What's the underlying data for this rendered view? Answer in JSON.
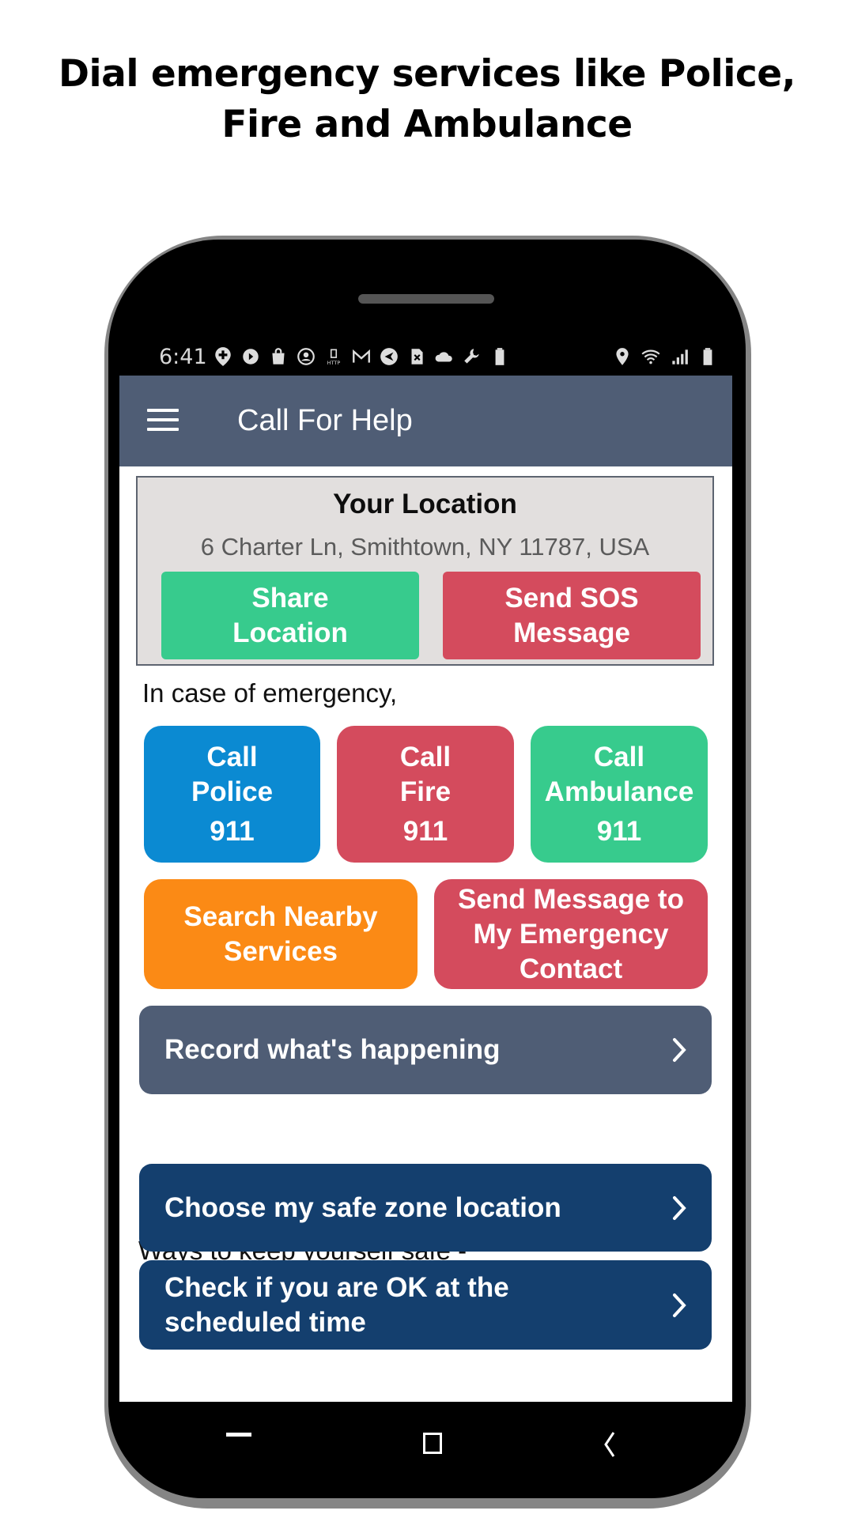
{
  "headline": {
    "line1": "Dial emergency services like Police,",
    "line2": "Fire and Ambulance"
  },
  "status_bar": {
    "time": "6:41",
    "left_icons": [
      "medical-location-icon",
      "play-icon",
      "shopping-bag-icon",
      "account-icon",
      "http-icon",
      "gmail-icon",
      "send-icon",
      "sim-error-icon",
      "cloud-icon",
      "wrench-icon",
      "battery-100-icon"
    ],
    "right_icons": [
      "location-icon",
      "wifi-icon",
      "signal-icon",
      "battery-icon"
    ]
  },
  "app_bar": {
    "menu_icon": "hamburger-menu-icon",
    "title": "Call For Help"
  },
  "location": {
    "title": "Your Location",
    "address": "6 Charter Ln, Smithtown, NY 11787, USA",
    "share_button": {
      "line1": "Share",
      "line2": "Location",
      "color": "#37cb8d"
    },
    "sos_button": {
      "line1": "Send SOS",
      "line2": "Message",
      "color": "#d44b5d"
    }
  },
  "emergency": {
    "label": "In case of emergency,",
    "tiles": [
      {
        "line1": "Call",
        "line2": "Police",
        "number": "911",
        "color": "#0b8ad2"
      },
      {
        "line1": "Call",
        "line2": "Fire",
        "number": "911",
        "color": "#d44b5d"
      },
      {
        "line1": "Call",
        "line2": "Ambulance",
        "number": "911",
        "color": "#37cb8d"
      }
    ],
    "search_nearby": {
      "line1": "Search Nearby",
      "line2": "Services",
      "color": "#fb8a15"
    },
    "send_message": {
      "line1": "Send Message to",
      "line2": "My Emergency",
      "line3": "Contact",
      "color": "#d44b5d"
    },
    "record": {
      "label": "Record what's happening",
      "icon": "chevron-right-icon",
      "color": "#4f5d75"
    }
  },
  "safety": {
    "label": "Ways to keep yourself safe -",
    "items": [
      {
        "line1": "Choose my safe zone location",
        "icon": "chevron-right-icon",
        "color": "#143f6e"
      },
      {
        "line1": "Check if you are OK at the",
        "line2": "scheduled time",
        "icon": "chevron-right-icon",
        "color": "#143f6e"
      }
    ]
  },
  "nav_bar": {
    "buttons": [
      "recent-apps-icon",
      "home-icon",
      "back-icon"
    ]
  },
  "colors": {
    "app_bar": "#4f5d75",
    "location_box_bg": "#e2dfde",
    "navy": "#143f6e"
  }
}
